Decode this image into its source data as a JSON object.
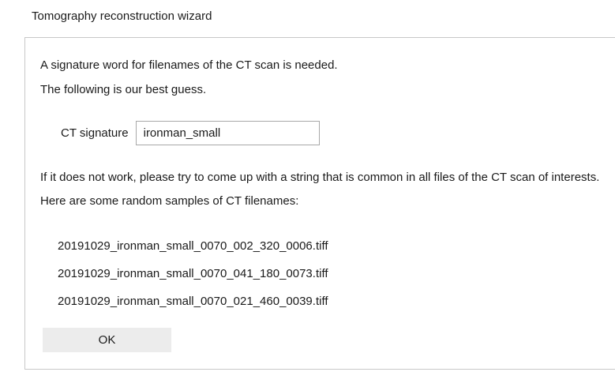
{
  "window": {
    "title": "Tomography reconstruction wizard"
  },
  "main": {
    "intro_line_1": "A signature word for filenames of the CT scan is needed.",
    "intro_line_2": "The following is our best guess.",
    "signature": {
      "label": "CT signature",
      "value": "ironman_small"
    },
    "hint_line_1": "If it does not work, please try to come up with a string that is common in all files of the CT scan of interests.",
    "hint_line_2": "Here are some random samples of CT filenames:",
    "samples": [
      "20191029_ironman_small_0070_002_320_0006.tiff",
      "20191029_ironman_small_0070_041_180_0073.tiff",
      "20191029_ironman_small_0070_021_460_0039.tiff"
    ],
    "ok_label": "OK"
  }
}
